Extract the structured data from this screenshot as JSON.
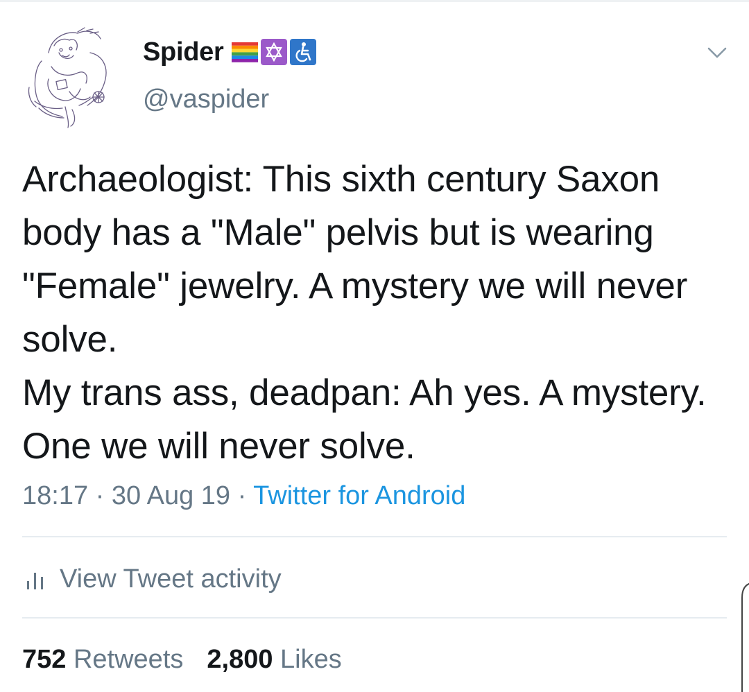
{
  "tweet": {
    "display_name": "Spider",
    "username": "@vaspider",
    "text": "Archaeologist: This sixth century Saxon body has a \"Male\" pelvis but is wearing \"Female\" jewelry. A mystery we will never solve.\nMy trans ass, deadpan: Ah yes. A mystery. One we will never solve.",
    "time": "18:17",
    "separator": "·",
    "date": "30 Aug 19",
    "source": "Twitter for Android"
  },
  "badges": [
    {
      "icon": "rainbow-flag-icon"
    },
    {
      "icon": "star-of-david-icon"
    },
    {
      "icon": "wheelchair-icon"
    }
  ],
  "activity": {
    "label": "View Tweet activity",
    "icon": "bar-chart-icon"
  },
  "stats": {
    "retweets_count": "752",
    "retweets_label": "Retweets",
    "likes_count": "2,800",
    "likes_label": "Likes"
  },
  "colors": {
    "text_primary": "#14171a",
    "text_secondary": "#657786",
    "link": "#1b95e0",
    "divider": "#e6ecf0",
    "badge_purple": "#9b59c9"
  }
}
